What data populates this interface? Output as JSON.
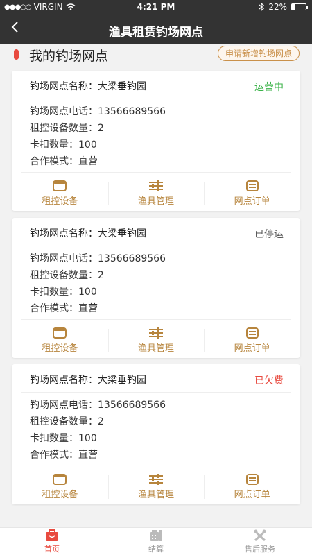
{
  "status_bar": {
    "carrier": "VIRGIN",
    "time": "4:21 PM",
    "battery": "22%"
  },
  "nav": {
    "title": "渔具租赁钓场网点"
  },
  "section": {
    "title": "我的钓场网点",
    "apply_button": "申请新增钓场网点"
  },
  "labels": {
    "name": "钓场网点名称：",
    "phone": "钓场网点电话：",
    "devices": "租控设备数量：",
    "buckles": "卡扣数量：",
    "mode": "合作模式："
  },
  "cards": [
    {
      "name": "大梁垂钓园",
      "status": "运营中",
      "status_color": "#3cb34a",
      "phone": "13566689566",
      "devices": "2",
      "buckles": "100",
      "mode": "直营"
    },
    {
      "name": "大梁垂钓园",
      "status": "已停运",
      "status_color": "#555555",
      "phone": "13566689566",
      "devices": "2",
      "buckles": "100",
      "mode": "直营"
    },
    {
      "name": "大梁垂钓园",
      "status": "已欠费",
      "status_color": "#e84a3f",
      "phone": "13566689566",
      "devices": "2",
      "buckles": "100",
      "mode": "直营"
    }
  ],
  "actions": {
    "rent_devices": "租控设备",
    "gear_manage": "渔具管理",
    "outlet_orders": "网点订单"
  },
  "tabs": [
    {
      "label": "首页",
      "icon": "home-icon",
      "active": true
    },
    {
      "label": "结算",
      "icon": "calculator-icon",
      "active": false
    },
    {
      "label": "售后服务",
      "icon": "tools-icon",
      "active": false
    }
  ],
  "colors": {
    "accent": "#c9904a",
    "action": "#b7853d",
    "brand_red": "#e84a3f",
    "header": "#333333"
  }
}
